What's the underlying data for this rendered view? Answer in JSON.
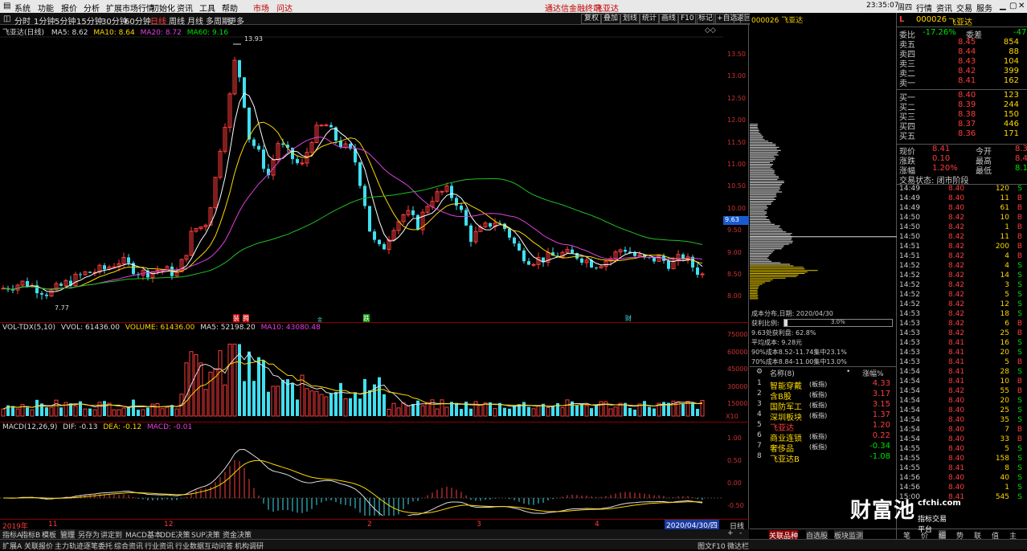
{
  "menubar": {
    "items": [
      "系统",
      "功能",
      "报价",
      "分析",
      "扩展市场行情",
      "初始化",
      "资讯",
      "工具",
      "帮助"
    ],
    "market": "市场",
    "news": "问达",
    "center_title": "通达信金融终端",
    "center_stock": "飞亚达",
    "time": "23:35:07",
    "weekday": "周四",
    "right_buttons": [
      "行情",
      "资讯",
      "交易",
      "服务"
    ]
  },
  "toolbar": {
    "periods": [
      "分时",
      "1分钟",
      "5分钟",
      "15分钟",
      "30分钟",
      "60分钟",
      "日线",
      "周线",
      "月线",
      "多周期",
      "更多"
    ],
    "right_buttons": [
      "复权",
      "叠加",
      "划线",
      "统计",
      "画线",
      "F10",
      "标记",
      "+自选",
      "返回"
    ]
  },
  "main_chart": {
    "title": "飞亚达(日线)",
    "ma5": "MA5: 8.62",
    "ma10": "MA10: 8.64",
    "ma20": "MA20: 8.72",
    "ma60": "MA60: 9.16",
    "y_ticks": [
      "13.50",
      "13.00",
      "12.50",
      "12.00",
      "11.50",
      "11.00",
      "10.50",
      "10.00",
      "9.50",
      "9.00",
      "8.50",
      "8.00"
    ],
    "high_label": "13.93",
    "low_label": "7.77",
    "current_price": "9.63",
    "markers": [
      "装",
      "腾",
      "金",
      "跌",
      "财"
    ],
    "colors": {
      "up": "#ff3c3c",
      "down": "#3fe0f0",
      "ma5": "#ffffff",
      "ma10": "#ffd700",
      "ma20": "#e040e0",
      "ma60": "#20c020"
    }
  },
  "vol_chart": {
    "title": "VOL-TDX(5,10)",
    "vvol": "VVOL: 61436.00",
    "volume": "VOLUME: 61436.00",
    "ma5": "MA5: 52198.20",
    "ma10": "MA10: 43080.48",
    "y_ticks": [
      "75000",
      "60000",
      "45000",
      "30000",
      "15000"
    ],
    "unit": "X10"
  },
  "macd_chart": {
    "title": "MACD(12,26,9)",
    "dif": "DIF: -0.13",
    "dea": "DEA: -0.12",
    "macd": "MACD: -0.01",
    "y_ticks": [
      "1.00",
      "0.50",
      "0.00",
      "-0.50"
    ]
  },
  "date_axis": {
    "labels": [
      "2019年",
      "11",
      "12",
      "2",
      "3",
      "4"
    ],
    "current": "2020/04/30/四",
    "period": "日线"
  },
  "bottom_tabs": [
    "指标A",
    "指标B",
    "模板",
    "管理",
    "另存为",
    "讲定到",
    "MACD基本",
    "DDE决策",
    "SUP决策",
    "资金决策"
  ],
  "status_bar": [
    "扩展A",
    "关联报价",
    "主力轨迹",
    "逐笔委托",
    "综合资讯",
    "行业资讯",
    "行业数据",
    "互动问答",
    "机构调研",
    "图文F10",
    "微达栏"
  ],
  "chip": {
    "stock_code": "000026",
    "stock_name": "飞亚达",
    "cost_date": "成本分布,日期: 2020/04/30",
    "profit_ratio_label": "获利比例:",
    "profit_ratio": "3.0%",
    "profit_line": "9.63处获利盘: 62.8%",
    "avg_cost": "平均成本: 9.28元",
    "cost90": "90%成本8.52-11.74集中23.1%",
    "cost70": "70%成本8.84-11.00集中13.0%"
  },
  "sector": {
    "header_name": "名称(8)",
    "header_change": "涨幅%",
    "rows": [
      {
        "no": "1",
        "name": "智能穿戴",
        "tag": "(板指)",
        "chg": "4.33"
      },
      {
        "no": "2",
        "name": "含B股",
        "tag": "(板指)",
        "chg": "3.17"
      },
      {
        "no": "3",
        "name": "国防军工",
        "tag": "(板指)",
        "chg": "3.15"
      },
      {
        "no": "4",
        "name": "深圳板块",
        "tag": "(板指)",
        "chg": "1.37"
      },
      {
        "no": "5",
        "name": "飞亚达",
        "tag": "",
        "chg": "1.20"
      },
      {
        "no": "6",
        "name": "商业连锁",
        "tag": "(板指)",
        "chg": "0.22"
      },
      {
        "no": "7",
        "name": "奢侈品",
        "tag": "(板指)",
        "chg": "-0.34"
      },
      {
        "no": "8",
        "name": "飞亚达B",
        "tag": "",
        "chg": "-1.08"
      }
    ],
    "tabs": [
      "关联品种",
      "自选股",
      "板块监测"
    ]
  },
  "quote": {
    "code": "000026",
    "name": "飞亚达",
    "weibi_label": "委比",
    "weibi": "-17.26%",
    "weicha_label": "委差",
    "weicha": "-47",
    "sell": [
      {
        "label": "卖五",
        "price": "8.45",
        "vol": "854"
      },
      {
        "label": "卖四",
        "price": "8.44",
        "vol": "88"
      },
      {
        "label": "卖三",
        "price": "8.43",
        "vol": "104"
      },
      {
        "label": "卖二",
        "price": "8.42",
        "vol": "399"
      },
      {
        "label": "卖一",
        "price": "8.41",
        "vol": "162"
      }
    ],
    "buy": [
      {
        "label": "买一",
        "price": "8.40",
        "vol": "123"
      },
      {
        "label": "买二",
        "price": "8.39",
        "vol": "244"
      },
      {
        "label": "买三",
        "price": "8.38",
        "vol": "150"
      },
      {
        "label": "买四",
        "price": "8.37",
        "vol": "446"
      },
      {
        "label": "买五",
        "price": "8.36",
        "vol": "171"
      }
    ],
    "now_label": "现价",
    "now": "8.41",
    "open_label": "今开",
    "open": "8.3",
    "chg_label": "涨跌",
    "chg": "0.10",
    "high_label": "最高",
    "high": "8.4",
    "pct_label": "涨幅",
    "pct": "1.20%",
    "low_label": "最低",
    "low": "8.1",
    "status": "交易状态: 闭市阶段"
  },
  "ticks": [
    [
      "14:49",
      "8.40",
      "120",
      "S"
    ],
    [
      "14:49",
      "8.40",
      "11",
      "B"
    ],
    [
      "14:49",
      "8.40",
      "61",
      "B"
    ],
    [
      "14:50",
      "8.42",
      "10",
      "B"
    ],
    [
      "14:50",
      "8.42",
      "1",
      "B"
    ],
    [
      "14:50",
      "8.42",
      "11",
      "B"
    ],
    [
      "14:51",
      "8.42",
      "200",
      "B"
    ],
    [
      "14:51",
      "8.42",
      "4",
      "B"
    ],
    [
      "14:52",
      "8.42",
      "4",
      "S"
    ],
    [
      "14:52",
      "8.42",
      "14",
      "S"
    ],
    [
      "14:52",
      "8.42",
      "3",
      "S"
    ],
    [
      "14:52",
      "8.42",
      "5",
      "S"
    ],
    [
      "14:52",
      "8.42",
      "12",
      "S"
    ],
    [
      "14:53",
      "8.42",
      "18",
      "S"
    ],
    [
      "14:53",
      "8.42",
      "6",
      "B"
    ],
    [
      "14:53",
      "8.42",
      "25",
      "B"
    ],
    [
      "14:53",
      "8.41",
      "16",
      "S"
    ],
    [
      "14:53",
      "8.41",
      "20",
      "S"
    ],
    [
      "14:53",
      "8.41",
      "5",
      "B"
    ],
    [
      "14:54",
      "8.41",
      "28",
      "S"
    ],
    [
      "14:54",
      "8.41",
      "10",
      "B"
    ],
    [
      "14:54",
      "8.42",
      "55",
      "B"
    ],
    [
      "14:54",
      "8.40",
      "20",
      "S"
    ],
    [
      "14:54",
      "8.40",
      "25",
      "S"
    ],
    [
      "14:54",
      "8.40",
      "35",
      "S"
    ],
    [
      "14:54",
      "8.40",
      "7",
      "B"
    ],
    [
      "14:54",
      "8.40",
      "33",
      "B"
    ],
    [
      "14:55",
      "8.40",
      "5",
      "S"
    ],
    [
      "14:55",
      "8.40",
      "158",
      "S"
    ],
    [
      "14:55",
      "8.41",
      "8",
      "S"
    ],
    [
      "14:56",
      "8.40",
      "40",
      "S"
    ],
    [
      "14:56",
      "8.40",
      "1",
      "S"
    ],
    [
      "15:00",
      "8.41",
      "545",
      "S"
    ]
  ],
  "quote_tabs": [
    "笔",
    "价",
    "细",
    "势",
    "联",
    "值",
    "主"
  ],
  "watermark": {
    "brand": "财富池",
    "url": "cfchi.com",
    "sub": "指标交易平台"
  }
}
